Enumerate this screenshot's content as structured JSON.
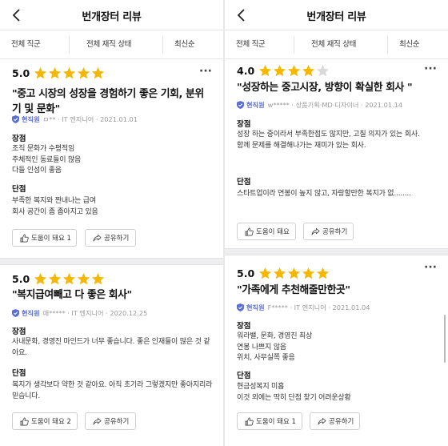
{
  "header": {
    "title": "번개장터 리뷰"
  },
  "filters": {
    "job": "전체 직군",
    "status": "전체 재직 상태",
    "sort": "최신순"
  },
  "colors": {
    "star": "#f5b700",
    "star_empty": "#d9d9d9",
    "accent": "#5b6ed1"
  },
  "labels": {
    "pros": "장점",
    "cons": "단점",
    "share": "공유하기"
  },
  "left_reviews": [
    {
      "score": "5.0",
      "stars": 5,
      "headline": "\"중고 시장의 성장을 경험하기 좋은 기회, 분위기 및 문화\"",
      "status": "현직원",
      "meta": "ㅁ** · IT 엔지니어 · 2021.01.01",
      "pros": "조직 문화가 수평적임\n주체적인 동료들이 많음\n다들 인성이 좋음",
      "cons": "부족한 복지와 짠내나는 급여\n회사 공간이 좀 좁아지고 있음",
      "helpful": "도움이 돼요 1"
    },
    {
      "score": "5.0",
      "stars": 5,
      "headline": "\"복지급여빼고 다 좋은 회사\"",
      "status": "현직원",
      "meta": "매***** · IT 엔지니어 · 2020.12.25",
      "pros": "사내문화, 경영진 마인드가 너무 좋습니다. 좋은 인재들이 많은 것 같아요.",
      "cons": "복지가 생각보다 약한 것 같아요. 아직 초기라 그렇겠지만 좋아지리라 믿습니다.",
      "helpful": "도움이 돼요 2"
    }
  ],
  "right_reviews": [
    {
      "score": "4.0",
      "stars": 4,
      "headline": "\"성장하는 중고시장, 방향이 확실한 회사 \"",
      "status": "현직원",
      "meta": "w***** · 상품기획·MD·디자이너 · 2021.01.14",
      "pros": "성장 하는 중이라서 부족한점도 많지만, 고칠 의지가 있는 회사.\n함께 문제를 해결해나가는 재미가 있는 회사.",
      "cons": "스타트업이라 연봉이 높지 않고, 자랑할만한 복지가 없........",
      "helpful": "도움이 돼요"
    },
    {
      "score": "5.0",
      "stars": 5,
      "headline": "\"가족에게 추천해줄만한곳\"",
      "status": "현직원",
      "meta": "F***** · IT 엔지니어 · 2021.01.04",
      "pros": "워라밸, 문화, 경영진 최상\n연봉 나쁘지 않음\n위치, 사무실쪽 좋음",
      "cons": "현금성복지 미흡\n이것 외에는 딱히 단점 찾기 어려운상황",
      "helpful": "도움이 돼요 1"
    }
  ]
}
